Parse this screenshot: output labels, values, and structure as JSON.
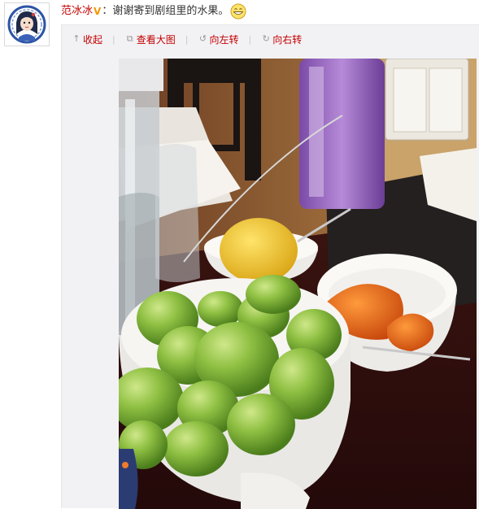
{
  "post": {
    "username": "范冰冰",
    "verified_badge": "V",
    "separator": "：",
    "text": "谢谢寄到剧组里的水果。",
    "emoji_icon": "grin-emoji-icon"
  },
  "media_toolbar": {
    "collapse": "收起",
    "view_large": "查看大图",
    "rotate_left": "向左转",
    "rotate_right": "向右转"
  },
  "colors": {
    "link_red": "#c40000",
    "verified_orange": "#f39800",
    "toolbar_bg": "#f2f2f5"
  }
}
